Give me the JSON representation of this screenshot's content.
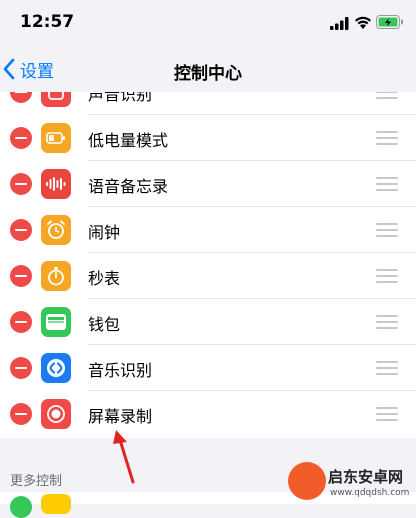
{
  "status_bar": {
    "time": "12:57"
  },
  "nav": {
    "back_label": "设置",
    "title": "控制中心"
  },
  "controls": [
    {
      "label": "声音识别",
      "icon": "sound-recognition-icon",
      "color": "#f04a48"
    },
    {
      "label": "低电量模式",
      "icon": "battery-icon",
      "color": "#f5a623"
    },
    {
      "label": "语音备忘录",
      "icon": "voice-memo-icon",
      "color": "#e8453c"
    },
    {
      "label": "闹钟",
      "icon": "alarm-icon",
      "color": "#f5a623"
    },
    {
      "label": "秒表",
      "icon": "stopwatch-icon",
      "color": "#f5a623"
    },
    {
      "label": "钱包",
      "icon": "wallet-icon",
      "color": "#34c759"
    },
    {
      "label": "音乐识别",
      "icon": "shazam-icon",
      "color": "#1e7cf2"
    },
    {
      "label": "屏幕录制",
      "icon": "screen-record-icon",
      "color": "#f04a48"
    }
  ],
  "more_section": {
    "title": "更多控制"
  },
  "watermark": {
    "title": "启东安卓网",
    "url": "www.qdqdsh.com"
  }
}
